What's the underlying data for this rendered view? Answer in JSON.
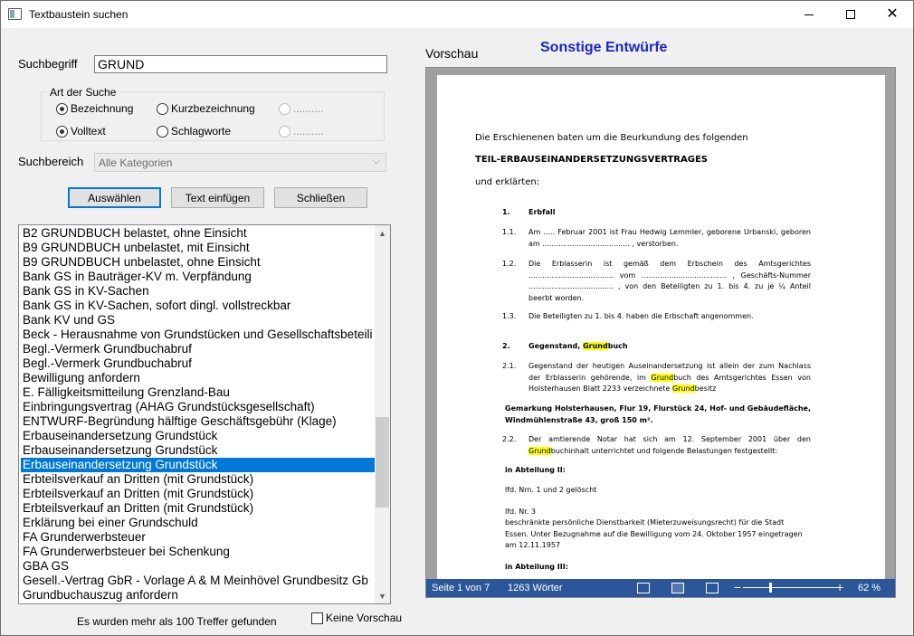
{
  "window": {
    "title": "Textbaustein suchen"
  },
  "search": {
    "label": "Suchbegriff",
    "value": "GRUND"
  },
  "search_type": {
    "legend": "Art der Suche",
    "options": [
      {
        "label": "Bezeichnung",
        "checked": true
      },
      {
        "label": "Kurzbezeichnung",
        "checked": false
      },
      {
        "label": "..........",
        "checked": false,
        "disabled": true
      },
      {
        "label": "Volltext",
        "checked": true
      },
      {
        "label": "Schlagworte",
        "checked": false
      },
      {
        "label": "..........",
        "checked": false,
        "disabled": true
      }
    ]
  },
  "search_area": {
    "label": "Suchbereich",
    "selected": "Alle Kategorien"
  },
  "buttons": {
    "select": "Auswählen",
    "insert": "Text einfügen",
    "close": "Schließen"
  },
  "results": {
    "items": [
      "B2 GRUNDBUCH belastet, ohne Einsicht",
      "B9 GRUNDBUCH unbelastet, mit Einsicht",
      "B9 GRUNDBUCH unbelastet, ohne Einsicht",
      "Bank GS in Bauträger-KV m. Verpfändung",
      "Bank GS in KV-Sachen",
      "Bank GS in KV-Sachen, sofort dingl. vollstreckbar",
      "Bank KV und GS",
      "Beck - Herausnahme von Grundstücken und Gesellschaftsbeteili",
      "Begl.-Vermerk Grundbuchabruf",
      "Begl.-Vermerk Grundbuchabruf",
      "Bewilligung anfordern",
      "E. Fälligkeitsmitteilung Grenzland-Bau",
      "Einbringungsvertrag (AHAG Grundstücksgesellschaft)",
      "ENTWURF-Begründung hälftige Geschäftsgebühr (Klage)",
      "Erbauseinandersetzung Grundstück",
      "Erbauseinandersetzung Grundstück",
      "Erbauseinandersetzung Grundstück",
      "Erbteilsverkauf an Dritten (mit Grundstück)",
      "Erbteilsverkauf an Dritten (mit Grundstück)",
      "Erbteilsverkauf an Dritten (mit Grundstück)",
      "Erklärung bei einer Grundschuld",
      "FA Grunderwerbsteuer",
      "FA Grunderwerbsteuer bei Schenkung",
      "GBA GS",
      "Gesell.-Vertrag GbR - Vorlage A & M Meinhövel Grundbesitz Gb",
      "Grundbuchauszug anfordern"
    ],
    "selected_index": 16,
    "message": "Es wurden mehr als 100 Treffer gefunden",
    "no_preview_label": "Keine Vorschau"
  },
  "preview": {
    "label": "Vorschau",
    "category": "Sonstige Entwürfe",
    "doc": {
      "intro": "Die Erschienenen baten um die Beurkundung des folgenden",
      "heading": "TEIL-ERBAUSEINANDERSETZUNGSVERTRAGES",
      "declared": "und erklärten:",
      "s1_num": "1.",
      "s1_title": "Erbfall",
      "s11_num": "1.1.",
      "s11_text": "Am ..... Februar 2001 ist Frau Hedwig Lemmler, geborene Urbanski, geboren am ...................................... , verstorben.",
      "s12_num": "1.2.",
      "s12_text": "Die Erblasserin ist gemäß dem Erbschein des Amtsgerichtes ..................................... vom ..................................... , Geschäfts-Nummer ..................................... , von den Beteiligten zu 1. bis 4. zu je ¼ Anteil beerbt worden.",
      "s13_num": "1.3.",
      "s13_text": "Die Beteiligten zu 1. bis 4. haben die Erbschaft angenommen.",
      "s2_num": "2.",
      "s2_title_a": "Gegenstand, ",
      "s2_title_hl": "Grund",
      "s2_title_b": "buch",
      "s21_num": "2.1.",
      "s21_a": "Gegenstand der heutigen Auseinandersetzung ist allein der zum Nachlass der Erblasserin gehörende, im ",
      "s21_hl1": "Grund",
      "s21_b": "buch des Amtsgerichtes Essen von Holsterhausen Blatt 2233 verzeichnete ",
      "s21_hl2": "Grund",
      "s21_c": "besitz",
      "parcel": "Gemarkung Holsterhausen, Flur 19, Flurstück 24, Hof- und Gebäudefläche, Windmühlenstraße 43, groß 150 m².",
      "s22_num": "2.2.",
      "s22_a": "Der amtierende Notar hat sich am 12. September 2001 über den ",
      "s22_hl": "Grund",
      "s22_b": "buchinhalt unterrichtet und folgende Belastungen festgestellt:",
      "abt2": "in Abteilung II:",
      "abt2_l1": "lfd. Nrn. 1 und 2 gelöscht",
      "abt2_l2": "lfd. Nr. 3",
      "abt2_l3": "beschränkte persönliche Dienstbarkeit (Mieterzuweisungsrecht) für die Stadt Essen. Unter Bezugnahme auf die Bewilligung vom 24. Oktober 1957 eingetragen am 12.11.1957",
      "abt3": "in Abteilung III:"
    },
    "status": {
      "page": "Seite 1 von 7",
      "words": "1263 Wörter",
      "zoom": "62 %",
      "zoom_value_percent": 62
    }
  }
}
